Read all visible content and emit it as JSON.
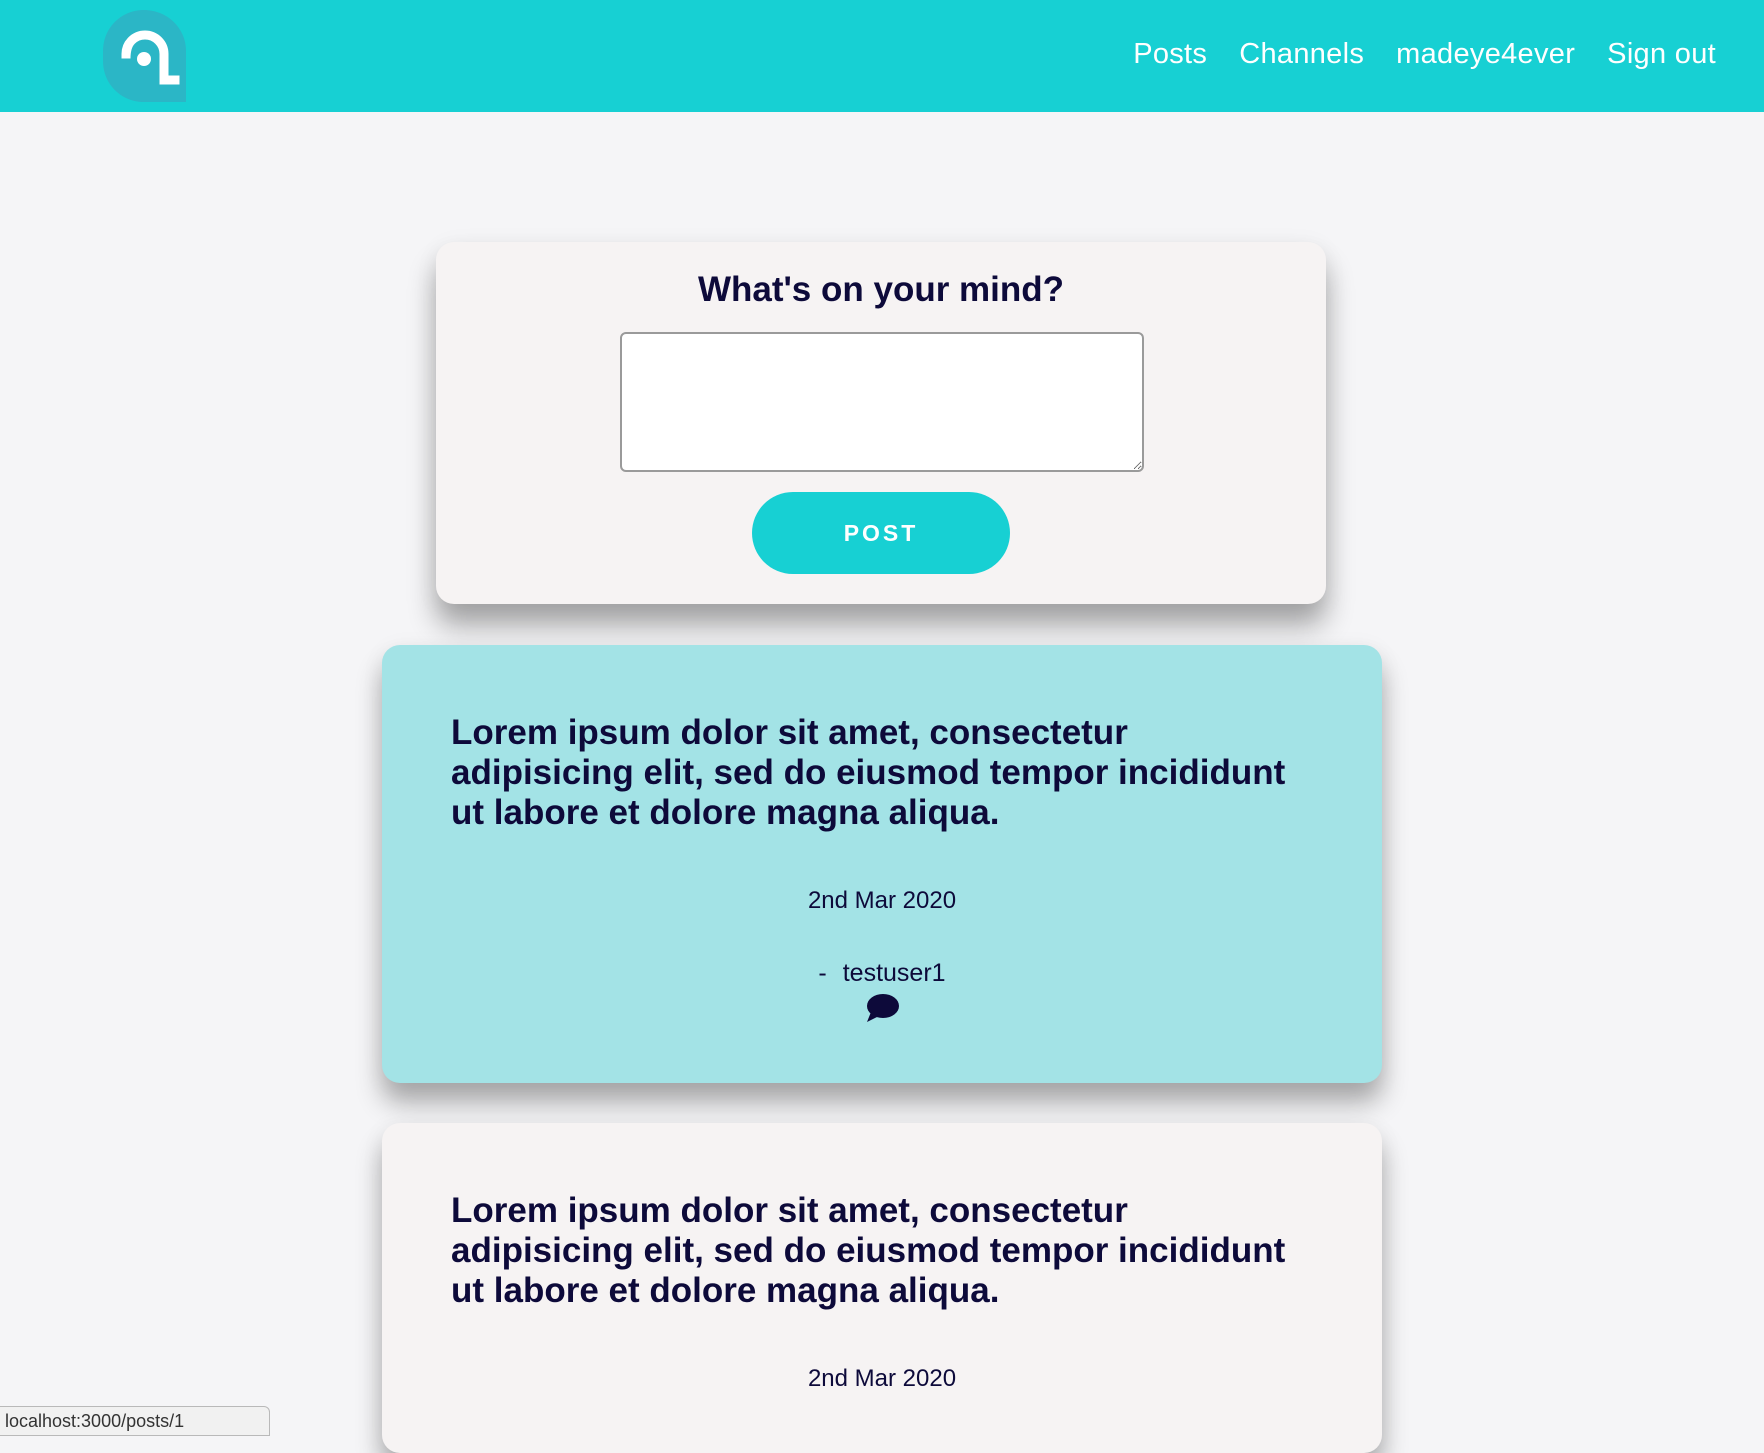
{
  "navbar": {
    "logo_name": "app-logo",
    "links": [
      "Posts",
      "Channels",
      "madeye4ever",
      "Sign out"
    ]
  },
  "composer": {
    "title": "What's on your mind?",
    "input_value": "",
    "input_placeholder": "",
    "post_label": "POST"
  },
  "posts": [
    {
      "text": "Lorem ipsum dolor sit amet, consectetur adipisicing elit, sed do eiusmod tempor incididunt ut labore et dolore magna aliqua.",
      "date": "2nd Mar 2020",
      "author_prefix": "-",
      "author": "testuser1",
      "comment_icon": "comment-icon"
    },
    {
      "text": "Lorem ipsum dolor sit amet, consectetur adipisicing elit, sed do eiusmod tempor incididunt ut labore et dolore magna aliqua.",
      "date": "2nd Mar 2020"
    }
  ],
  "status_bar": {
    "url": "localhost:3000/posts/1"
  },
  "colors": {
    "accent": "#17d0d3",
    "highlight_card": "#a3e3e6",
    "card": "#f6f3f3",
    "text": "#0d0a3a",
    "background": "#f5f5f7"
  }
}
